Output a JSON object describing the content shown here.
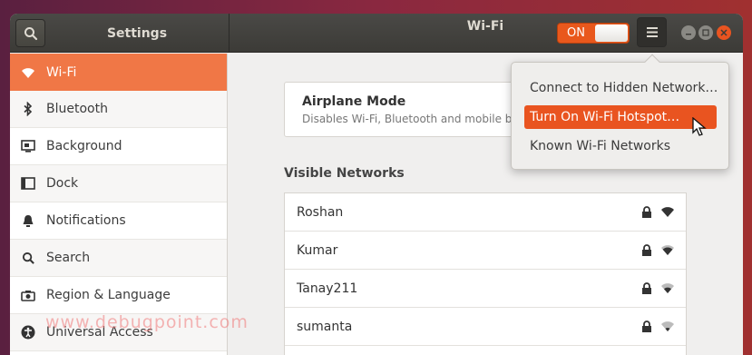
{
  "window": {
    "app_title": "Settings",
    "page_title": "Wi-Fi"
  },
  "wifi_toggle": {
    "label": "ON",
    "state": "on"
  },
  "sidebar": {
    "items": [
      {
        "label": "Wi-Fi",
        "icon": "wifi-icon",
        "active": true
      },
      {
        "label": "Bluetooth",
        "icon": "bluetooth-icon"
      },
      {
        "label": "Background",
        "icon": "background-icon"
      },
      {
        "label": "Dock",
        "icon": "dock-icon"
      },
      {
        "label": "Notifications",
        "icon": "bell-icon"
      },
      {
        "label": "Search",
        "icon": "search-icon"
      },
      {
        "label": "Region & Language",
        "icon": "camera-icon"
      },
      {
        "label": "Universal Access",
        "icon": "accessibility-icon"
      }
    ]
  },
  "airplane": {
    "title": "Airplane Mode",
    "subtitle": "Disables Wi-Fi, Bluetooth and mobile broadband"
  },
  "networks": {
    "heading": "Visible Networks",
    "items": [
      {
        "name": "Roshan",
        "secured": true
      },
      {
        "name": "Kumar",
        "secured": true
      },
      {
        "name": "Tanay211",
        "secured": true
      },
      {
        "name": "sumanta",
        "secured": true
      }
    ]
  },
  "menu": {
    "items": [
      {
        "label": "Connect to Hidden Network…"
      },
      {
        "label": "Turn On Wi-Fi Hotspot…",
        "highlighted": true
      },
      {
        "label": "Known Wi-Fi Networks"
      }
    ]
  },
  "watermark": "www.debugpoint.com",
  "colors": {
    "accent": "#e95420",
    "sidebar_active": "#f07746",
    "titlebar": "#3c3b37"
  }
}
